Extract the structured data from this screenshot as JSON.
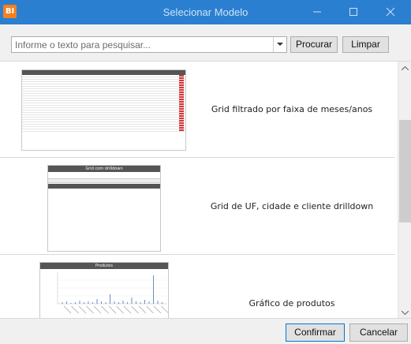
{
  "window": {
    "app_icon_text": "BI",
    "title": "Selecionar Modelo"
  },
  "search": {
    "placeholder": "Informe o texto para pesquisar...",
    "value": "",
    "search_button": "Procurar",
    "clear_button": "Limpar"
  },
  "models": [
    {
      "label": "Grid filtrado por faixa de meses/anos"
    },
    {
      "label": "Grid de UF, cidade e cliente drilldown",
      "thumb_title": "Grid com drilldown"
    },
    {
      "label": "Gráfico de produtos",
      "thumb_title": "Produtos"
    }
  ],
  "footer": {
    "confirm_button": "Confirmar",
    "cancel_button": "Cancelar"
  },
  "colors": {
    "titlebar": "#2b7fd0",
    "app_icon": "#f4801f",
    "accent_border": "#0078d7"
  }
}
